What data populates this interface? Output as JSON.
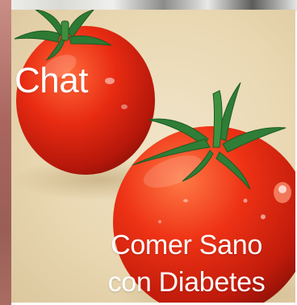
{
  "tile": {
    "label": "Chat",
    "title_line_1": "Comer Sano",
    "title_line_2": "con Diabetes"
  },
  "icons": {
    "left_tomato": "tomato-icon",
    "right_tomato": "tomato-icon"
  },
  "colors": {
    "tomato_red": "#d8230f",
    "stem_green": "#2f7a35",
    "background_cream": "#efe2c3"
  }
}
